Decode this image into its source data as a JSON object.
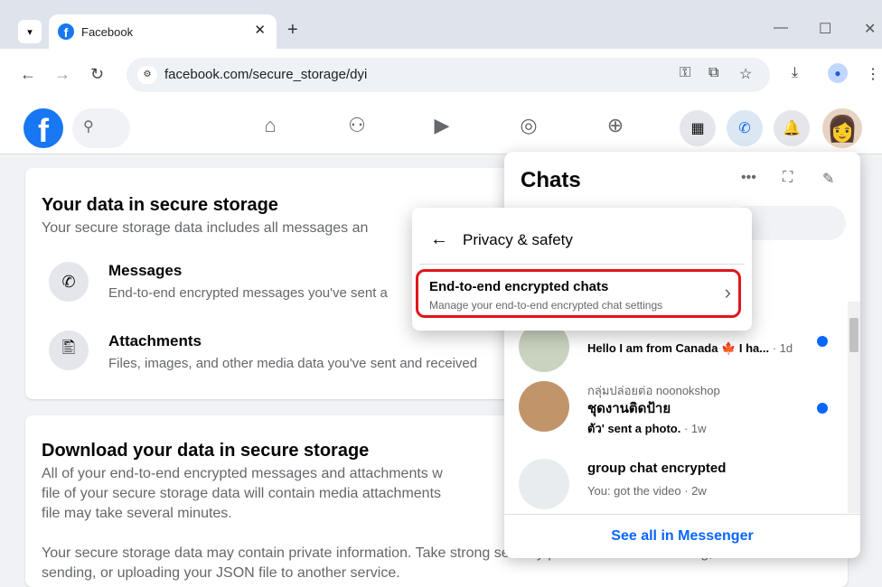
{
  "browser": {
    "tab_title": "Facebook",
    "url": "facebook.com/secure_storage/dyi"
  },
  "main": {
    "card1": {
      "title": "Your data in secure storage",
      "subtitle": "Your secure storage data includes all messages an",
      "items": [
        {
          "title": "Messages",
          "desc": "End-to-end encrypted messages you've sent a"
        },
        {
          "title": "Attachments",
          "desc": "Files, images, and other media data you've sent and received"
        }
      ]
    },
    "card2": {
      "title": "Download your data in secure storage",
      "lines": [
        "All of your end-to-end encrypted messages and attachments w",
        "file of your secure storage data will contain media attachments",
        "file may take several minutes."
      ],
      "line4": "Your secure storage data may contain private information. Take strong security precautions when storing,",
      "line5": "sending, or uploading your JSON file to another service."
    }
  },
  "chats": {
    "title": "Chats",
    "see_all": "See all in Messenger",
    "rows": [
      {
        "name": "",
        "message": "Hello I am from Canada 🍁 I ha...",
        "time": " · 1d",
        "unread": true
      },
      {
        "subtitle": "กลุ่มปล่อยต่อ noonokshop",
        "name": "ชุดงานติดป้าย",
        "message": "ตัว' sent a photo.",
        "time": " · 1w",
        "unread": true
      },
      {
        "name": "group chat encrypted",
        "message": "You: got the video",
        "time": " · 2w",
        "unread": false
      }
    ]
  },
  "popup": {
    "title": "Privacy & safety",
    "option_title": "End-to-end encrypted chats",
    "option_desc": "Manage your end-to-end encrypted chat settings"
  },
  "colors": {
    "brand": "#1877f2",
    "highlight": "#e0161b",
    "link": "#0866ff"
  }
}
